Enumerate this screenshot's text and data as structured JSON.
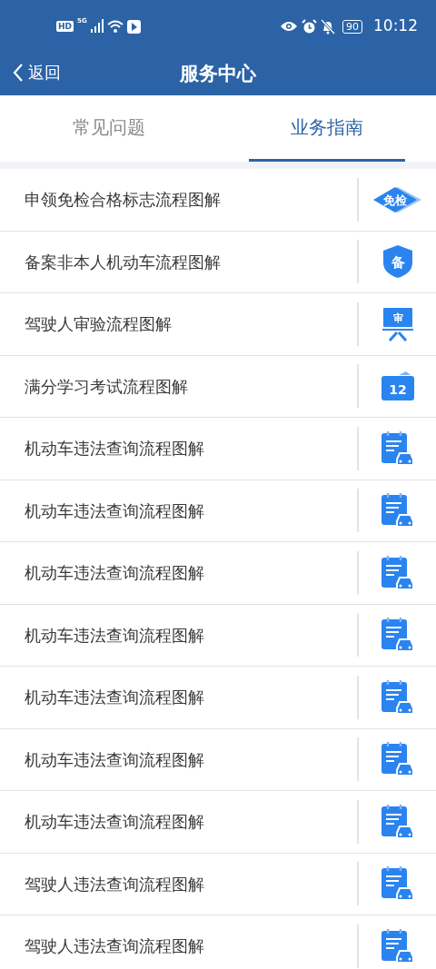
{
  "status_bar": {
    "hd": "HD",
    "network": "5G",
    "battery": "90",
    "time": "10:12"
  },
  "header": {
    "back": "返回",
    "title": "服务中心"
  },
  "tabs": [
    {
      "label": "常见问题",
      "selected": false
    },
    {
      "label": "业务指南",
      "selected": true
    }
  ],
  "items": [
    {
      "label": "申领免检合格标志流程图解",
      "icon": {
        "kind": "diamond",
        "text": "免检"
      }
    },
    {
      "label": "备案非本人机动车流程图解",
      "icon": {
        "kind": "shield",
        "text": "备"
      }
    },
    {
      "label": "驾驶人审验流程图解",
      "icon": {
        "kind": "easel",
        "text": "审"
      }
    },
    {
      "label": "满分学习考试流程图解",
      "icon": {
        "kind": "folder",
        "text": "12"
      }
    },
    {
      "label": "机动车违法查询流程图解",
      "icon": {
        "kind": "notepad-car"
      }
    },
    {
      "label": "机动车违法查询流程图解",
      "icon": {
        "kind": "notepad-car"
      }
    },
    {
      "label": "机动车违法查询流程图解",
      "icon": {
        "kind": "notepad-car"
      }
    },
    {
      "label": "机动车违法查询流程图解",
      "icon": {
        "kind": "notepad-car"
      }
    },
    {
      "label": "机动车违法查询流程图解",
      "icon": {
        "kind": "notepad-car"
      }
    },
    {
      "label": "机动车违法查询流程图解",
      "icon": {
        "kind": "notepad-car"
      }
    },
    {
      "label": "机动车违法查询流程图解",
      "icon": {
        "kind": "notepad-car"
      }
    },
    {
      "label": "驾驶人违法查询流程图解",
      "icon": {
        "kind": "notepad-car"
      }
    },
    {
      "label": "驾驶人违法查询流程图解",
      "icon": {
        "kind": "notepad-car"
      }
    }
  ]
}
